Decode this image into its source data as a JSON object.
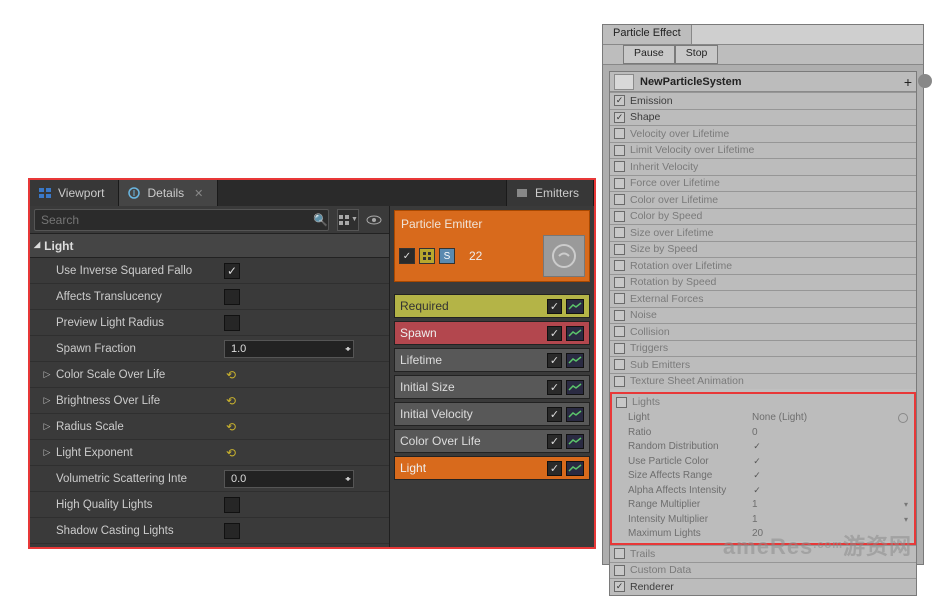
{
  "ue": {
    "tabs": {
      "viewport": "Viewport",
      "details": "Details",
      "emitters": "Emitters"
    },
    "search_placeholder": "Search",
    "category": "Light",
    "props": {
      "inv_falloff": "Use Inverse Squared Fallo",
      "affects_trans": "Affects Translucency",
      "preview_radius": "Preview Light Radius",
      "spawn_fraction": "Spawn Fraction",
      "spawn_fraction_val": "1.0",
      "color_scale": "Color Scale Over Life",
      "brightness": "Brightness Over Life",
      "radius_scale": "Radius Scale",
      "light_exp": "Light Exponent",
      "vol_scatter": "Volumetric Scattering Inte",
      "vol_scatter_val": "0.0",
      "hq_lights": "High Quality Lights",
      "shadow_lights": "Shadow Casting Lights"
    },
    "emitter": {
      "title": "Particle Emitter",
      "count": "22",
      "mods": {
        "required": "Required",
        "spawn": "Spawn",
        "lifetime": "Lifetime",
        "initial_size": "Initial Size",
        "initial_vel": "Initial Velocity",
        "color_life": "Color Over Life",
        "light": "Light"
      }
    }
  },
  "un": {
    "tab": "Particle Effect",
    "pause": "Pause",
    "stop": "Stop",
    "system_name": "NewParticleSystem",
    "modules": {
      "emission": "Emission",
      "shape": "Shape",
      "vel_life": "Velocity over Lifetime",
      "limit_vel": "Limit Velocity over Lifetime",
      "inherit_vel": "Inherit Velocity",
      "force_life": "Force over Lifetime",
      "color_life": "Color over Lifetime",
      "color_speed": "Color by Speed",
      "size_life": "Size over Lifetime",
      "size_speed": "Size by Speed",
      "rot_life": "Rotation over Lifetime",
      "rot_speed": "Rotation by Speed",
      "ext_forces": "External Forces",
      "noise": "Noise",
      "collision": "Collision",
      "triggers": "Triggers",
      "sub_em": "Sub Emitters",
      "tex_sheet": "Texture Sheet Animation",
      "lights": "Lights",
      "trails": "Trails",
      "custom": "Custom Data",
      "renderer": "Renderer"
    },
    "light_props": {
      "light_l": "Light",
      "light_v": "None (Light)",
      "ratio_l": "Ratio",
      "ratio_v": "0",
      "rand_l": "Random Distribution",
      "part_color_l": "Use Particle Color",
      "size_range_l": "Size Affects Range",
      "alpha_int_l": "Alpha Affects Intensity",
      "range_mult_l": "Range Multiplier",
      "range_mult_v": "1",
      "int_mult_l": "Intensity Multiplier",
      "int_mult_v": "1",
      "max_lights_l": "Maximum Lights",
      "max_lights_v": "20"
    }
  }
}
